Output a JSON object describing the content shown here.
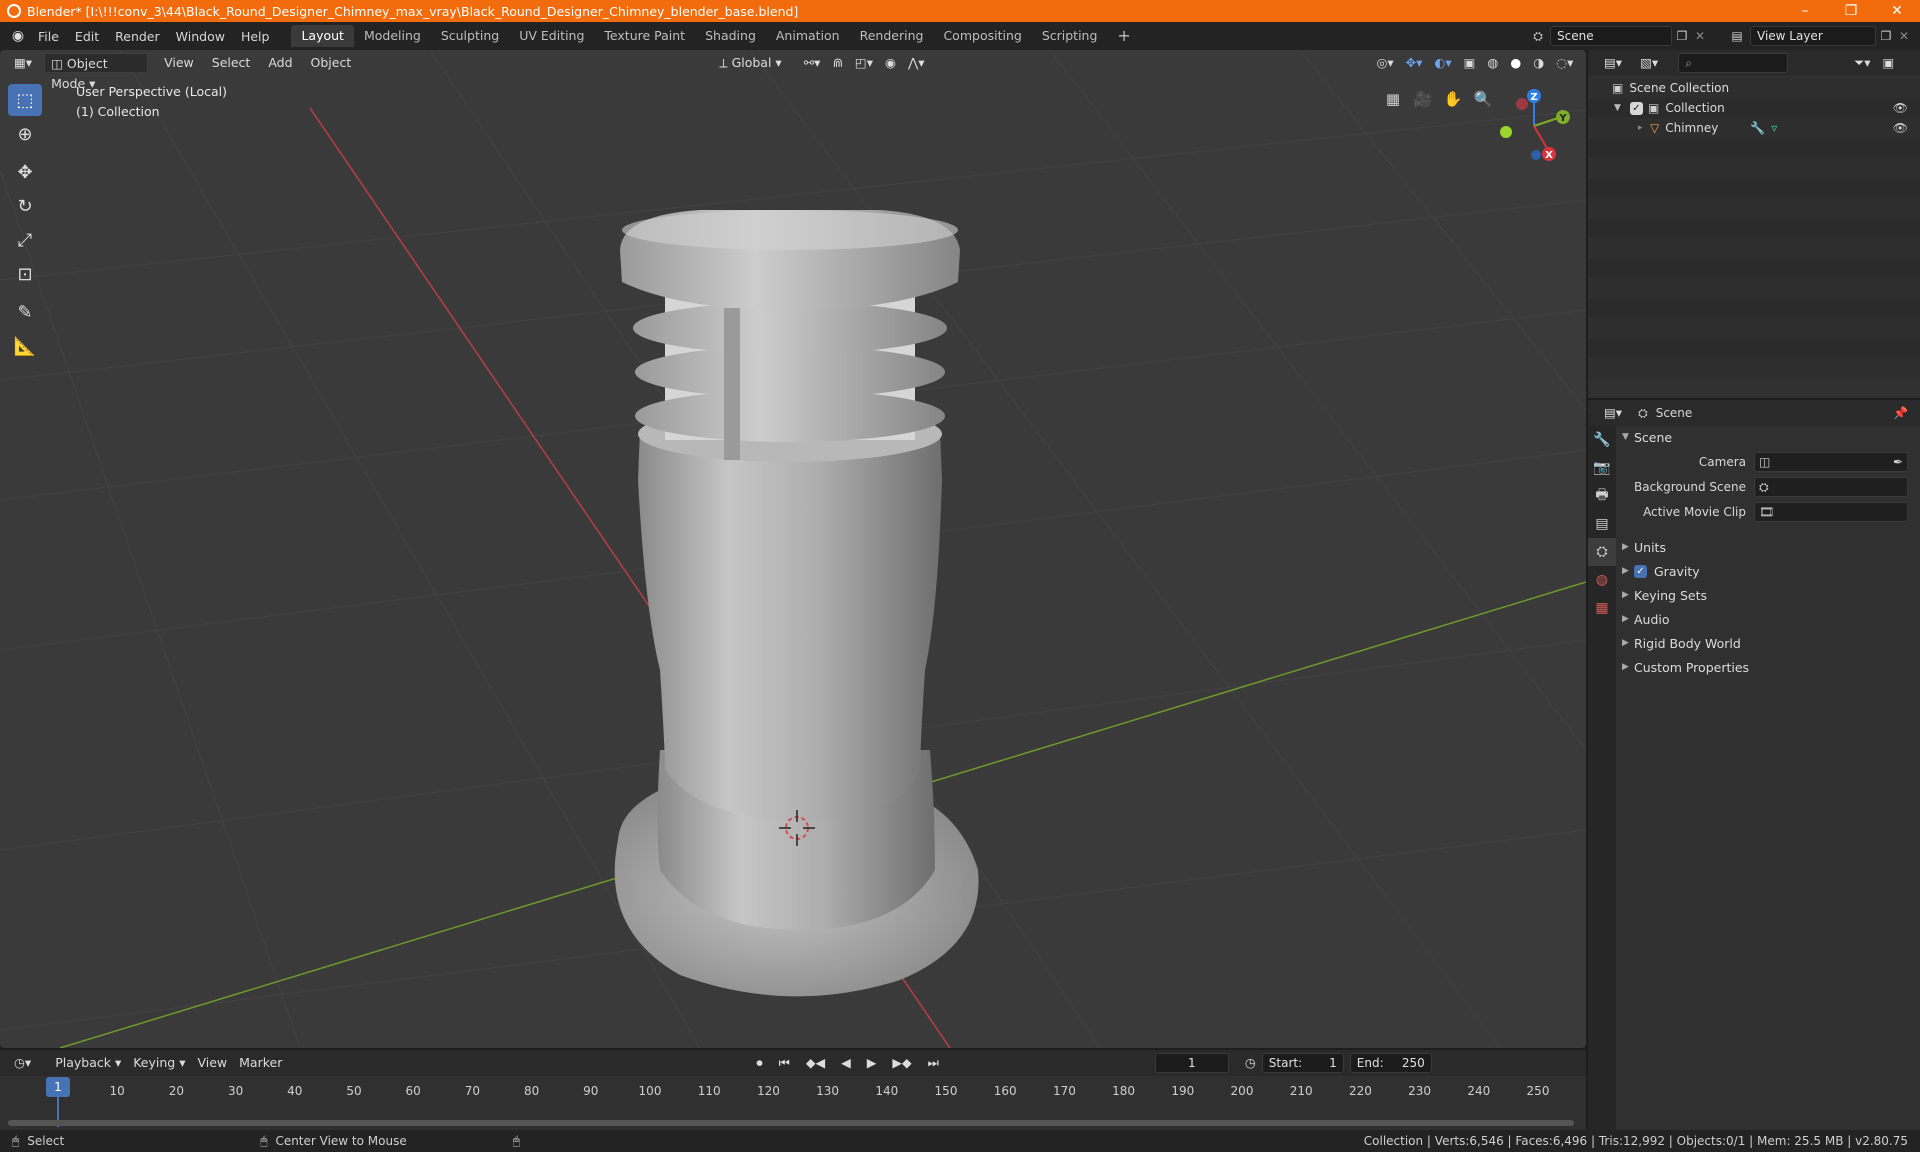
{
  "titlebar": {
    "title": "Blender* [I:\\!!!conv_3\\44\\Black_Round_Designer_Chimney_max_vray\\Black_Round_Designer_Chimney_blender_base.blend]",
    "minimize": "–",
    "maximize": "❐",
    "close": "✕"
  },
  "menu": [
    "File",
    "Edit",
    "Render",
    "Window",
    "Help"
  ],
  "workspaces": [
    "Layout",
    "Modeling",
    "Sculpting",
    "UV Editing",
    "Texture Paint",
    "Shading",
    "Animation",
    "Rendering",
    "Compositing",
    "Scripting"
  ],
  "active_workspace": "Layout",
  "add_workspace": "+",
  "scene_field": "Scene",
  "view_layer_field": "View Layer",
  "viewport": {
    "mode": "Object Mode",
    "menus": [
      "View",
      "Select",
      "Add",
      "Object"
    ],
    "orientation": "Global",
    "perspective_label": "User Perspective (Local)",
    "collection_label": "(1) Collection",
    "gizmo": {
      "x": "X",
      "y": "Y",
      "z": "Z"
    }
  },
  "outliner": {
    "search_placeholder": "",
    "scene_collection": "Scene Collection",
    "collection": "Collection",
    "object": "Chimney"
  },
  "properties": {
    "header": "Scene",
    "scene_section": "Scene",
    "camera_label": "Camera",
    "background_scene_label": "Background Scene",
    "active_movie_clip_label": "Active Movie Clip",
    "sections": {
      "units": "Units",
      "gravity": "Gravity",
      "keying_sets": "Keying Sets",
      "audio": "Audio",
      "rigid_body_world": "Rigid Body World",
      "custom_properties": "Custom Properties"
    },
    "gravity_enabled": true
  },
  "timeline": {
    "menus": [
      "Playback",
      "Keying",
      "View",
      "Marker"
    ],
    "current_frame": "1",
    "start_label": "Start:",
    "start_value": "1",
    "end_label": "End:",
    "end_value": "250",
    "playhead": "1",
    "ticks": [
      "10",
      "20",
      "30",
      "40",
      "50",
      "60",
      "70",
      "80",
      "90",
      "100",
      "110",
      "120",
      "130",
      "140",
      "150",
      "160",
      "170",
      "180",
      "190",
      "200",
      "210",
      "220",
      "230",
      "240",
      "250"
    ]
  },
  "status": {
    "select": "Select",
    "center_view": "Center View to Mouse",
    "stats": "Collection | Verts:6,546 | Faces:6,496 | Tris:12,992 | Objects:0/1 | Mem: 25.5 MB | v2.80.75"
  },
  "colors": {
    "titlebar": "#f26c0d",
    "accent": "#4772b3",
    "x_axis": "#d8343f",
    "y_axis": "#7fae2b",
    "z_axis": "#2d7ee6"
  }
}
